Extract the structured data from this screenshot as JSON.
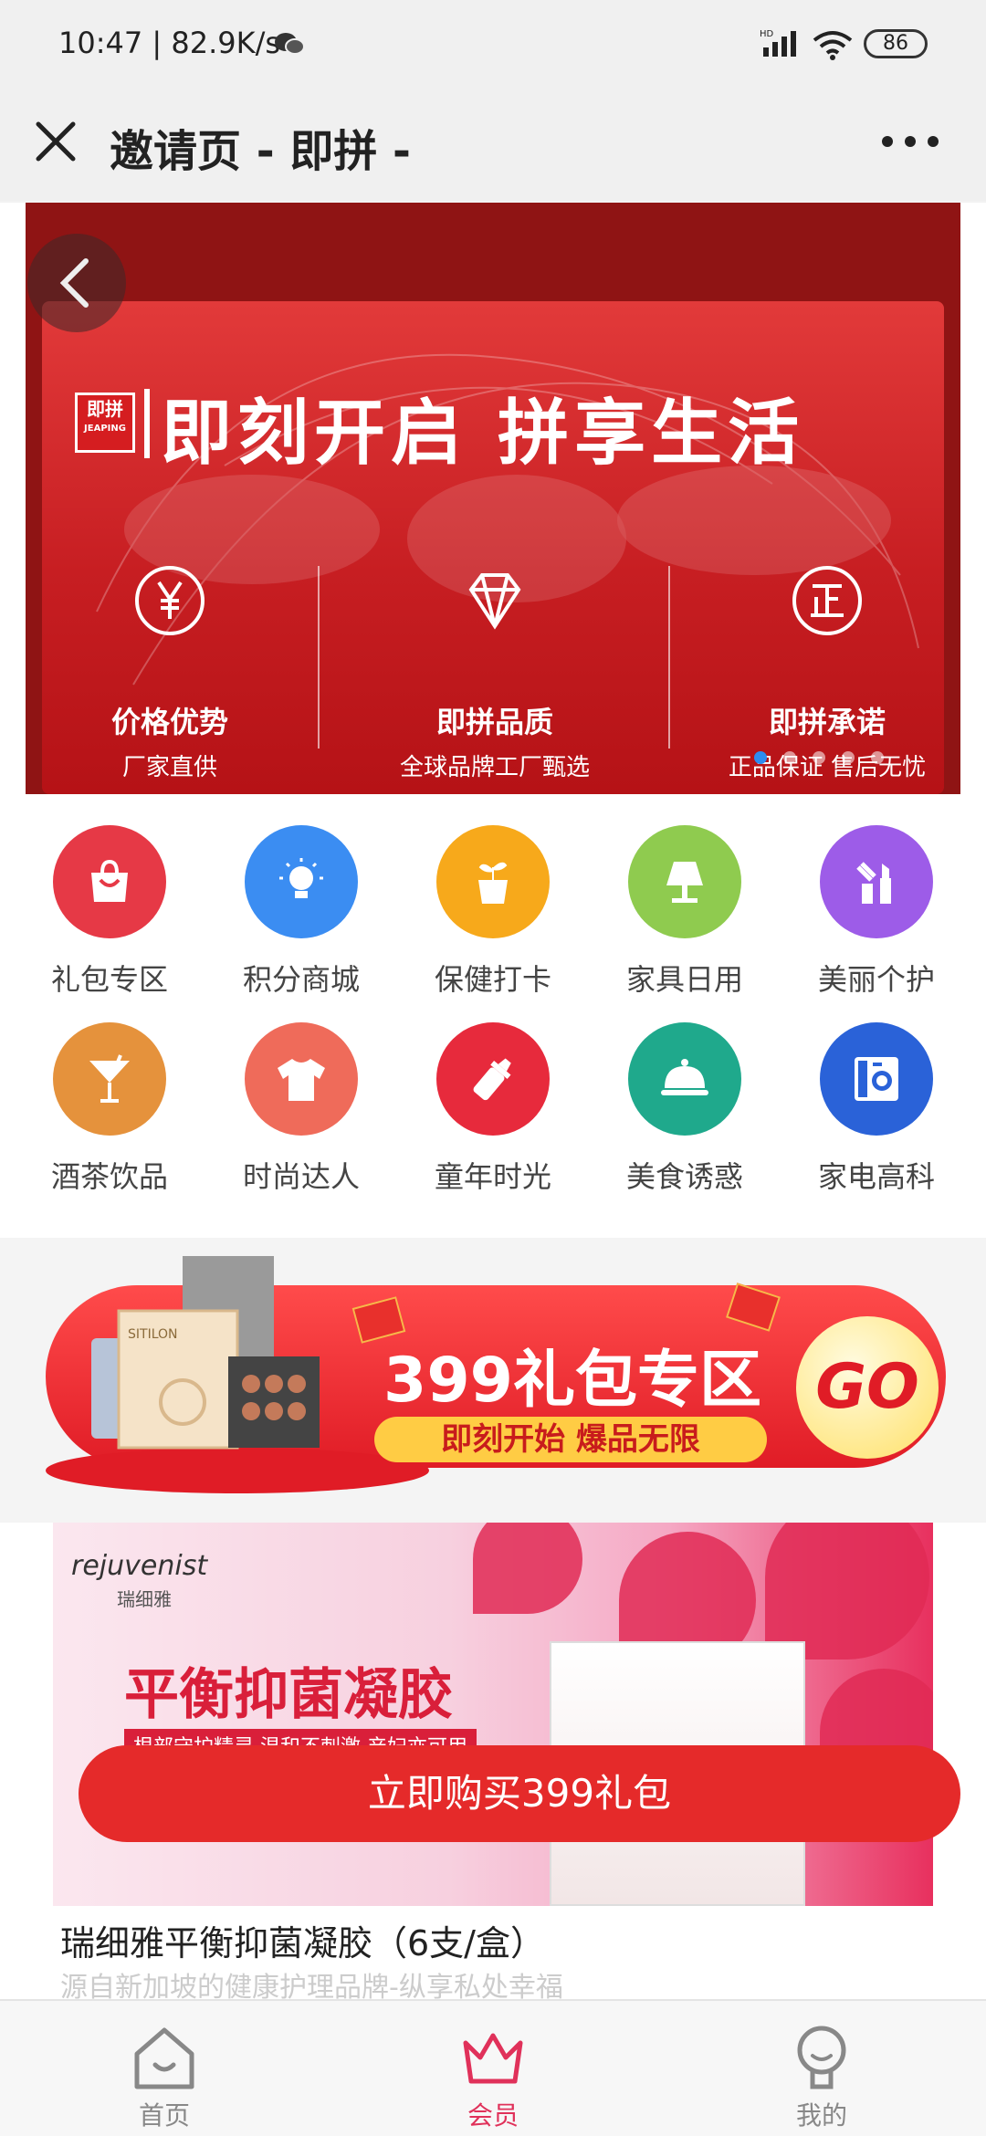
{
  "status_bar": {
    "time": "10:47 | 82.9K/s",
    "battery": "86"
  },
  "title_bar": {
    "title": "邀请页 - 即拼 -"
  },
  "hero": {
    "logo_cn": "即拼",
    "logo_en": "JEAPING",
    "slogan": "即刻开启  拼享生活",
    "features": [
      {
        "title": "价格优势",
        "subtitle": "厂家直供"
      },
      {
        "title": "即拼品质",
        "subtitle": "全球品牌工厂甄选"
      },
      {
        "title": "即拼承诺",
        "subtitle": "正品保证 售后无忧"
      }
    ],
    "slide_index": 1,
    "slide_count": 5
  },
  "categories": [
    {
      "label": "礼包专区",
      "color": "#e63946",
      "icon": "gift-bag-icon"
    },
    {
      "label": "积分商城",
      "color": "#3b8df2",
      "icon": "lightbulb-icon"
    },
    {
      "label": "保健打卡",
      "color": "#f7a91b",
      "icon": "plant-pot-icon"
    },
    {
      "label": "家具日用",
      "color": "#8fcb4f",
      "icon": "lamp-icon"
    },
    {
      "label": "美丽个护",
      "color": "#9d5ce8",
      "icon": "lipstick-icon"
    },
    {
      "label": "酒茶饮品",
      "color": "#e5923c",
      "icon": "cocktail-icon"
    },
    {
      "label": "时尚达人",
      "color": "#ef6b5a",
      "icon": "tshirt-icon"
    },
    {
      "label": "童年时光",
      "color": "#e72a3c",
      "icon": "baby-bottle-icon"
    },
    {
      "label": "美食诱惑",
      "color": "#1fa98c",
      "icon": "food-cloche-icon"
    },
    {
      "label": "家电高科",
      "color": "#2a62d8",
      "icon": "washing-machine-icon"
    }
  ],
  "promo": {
    "headline": "399礼包专区",
    "subline": "即刻开始 爆品无限",
    "go": "GO",
    "pkg_brand": "SITILON"
  },
  "product": {
    "brand": "rejuvenist",
    "brand_cn": "瑞细雅",
    "image_title": "平衡抑菌凝胶",
    "image_tag": "根部守护精灵 温和不刺激 产妇亦可用",
    "title": "瑞细雅平衡抑菌凝胶（6支/盒）",
    "description": "源自新加坡的健康护理品牌-纵享私处幸福"
  },
  "buy_button": "立即购买399礼包",
  "bottom_nav": {
    "items": [
      {
        "label": "首页",
        "icon": "home-icon",
        "active": false
      },
      {
        "label": "会员",
        "icon": "crown-icon",
        "active": true
      },
      {
        "label": "我的",
        "icon": "profile-icon",
        "active": false
      }
    ],
    "active_color": "#e0315a"
  }
}
